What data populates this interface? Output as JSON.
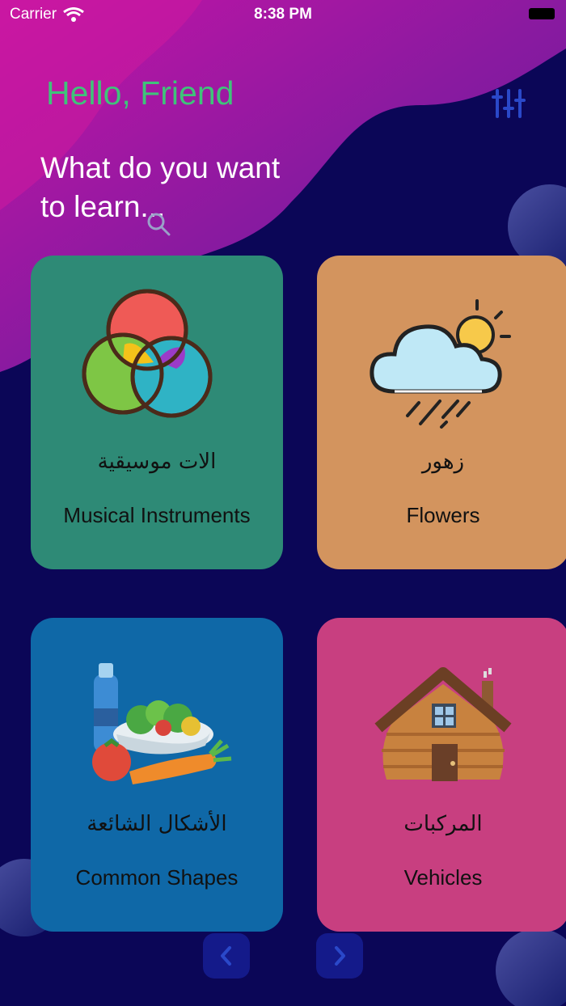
{
  "status_bar": {
    "carrier": "Carrier",
    "time": "8:38 PM"
  },
  "header": {
    "greeting": "Hello, Friend",
    "subtitle": "What do you want to learn..."
  },
  "colors": {
    "background": "#0b0657",
    "accent_green": "#3fc37a",
    "filter_icon": "#2a48c9"
  },
  "categories": [
    {
      "arabic": "الات موسيقية",
      "english": "Musical Instruments",
      "color": "#2e8a76",
      "icon": "venn-circles-icon"
    },
    {
      "arabic": "زهور",
      "english": "Flowers",
      "color": "#d3945e",
      "icon": "weather-cloud-icon"
    },
    {
      "arabic": "الأشكال الشائعة",
      "english": "Common Shapes",
      "color": "#0f68a7",
      "icon": "food-basket-icon"
    },
    {
      "arabic": "المركبات",
      "english": "Vehicles",
      "color": "#c83f80",
      "icon": "wooden-cabin-icon"
    }
  ],
  "pagination": {
    "prev_icon": "chevron-left-icon",
    "next_icon": "chevron-right-icon"
  }
}
